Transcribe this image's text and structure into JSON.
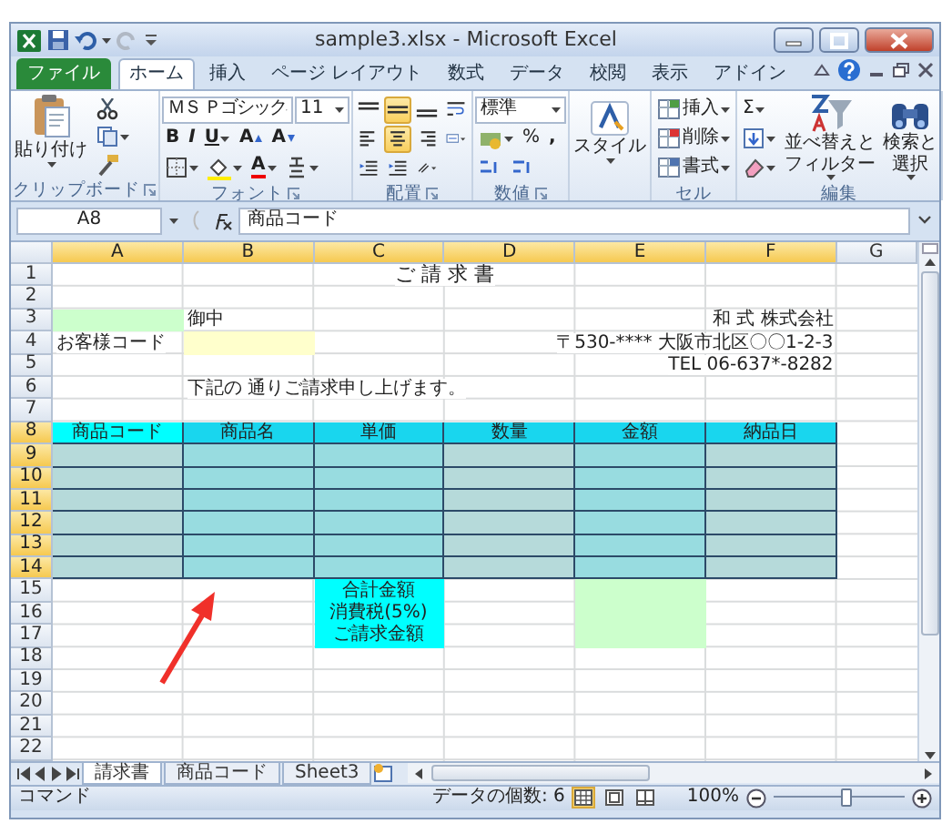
{
  "window": {
    "title": "sample3.xlsx - Microsoft Excel"
  },
  "ribbon_tabs": [
    {
      "label": "ファイル",
      "kind": "file",
      "selected": false
    },
    {
      "label": "ホーム",
      "kind": "tab",
      "selected": true
    },
    {
      "label": "挿入",
      "kind": "tab",
      "selected": false
    },
    {
      "label": "ページ レイアウト",
      "kind": "tab",
      "selected": false
    },
    {
      "label": "数式",
      "kind": "tab",
      "selected": false
    },
    {
      "label": "データ",
      "kind": "tab",
      "selected": false
    },
    {
      "label": "校閲",
      "kind": "tab",
      "selected": false
    },
    {
      "label": "表示",
      "kind": "tab",
      "selected": false
    },
    {
      "label": "アドイン",
      "kind": "tab",
      "selected": false
    }
  ],
  "clipboard": {
    "paste": "貼り付け",
    "label": "クリップボード"
  },
  "font": {
    "name": "ＭＳ Ｐゴシック",
    "size": "11",
    "bold": "B",
    "italic": "I",
    "underline": "U",
    "grow": "A",
    "shrink": "A",
    "font_color": "A",
    "label": "フォント"
  },
  "alignment": {
    "label": "配置",
    "buttons": [
      {
        "on": false
      },
      {
        "on": true
      },
      {
        "on": false
      },
      {
        "on": false
      },
      {
        "on": false
      },
      {
        "on": true
      },
      {
        "on": false
      },
      {
        "on": false
      },
      {
        "on": false
      },
      {
        "on": false
      },
      {
        "on": false
      }
    ]
  },
  "number": {
    "format": "標準",
    "percent": "%",
    "comma": ",",
    "label": "数値"
  },
  "styles": {
    "button": "スタイル"
  },
  "cells": {
    "insert": "挿入",
    "delete": "削除",
    "format": "書式",
    "label": "セル"
  },
  "editing": {
    "sum": "Σ",
    "sort": [
      "並べ替えと",
      "フィルター"
    ],
    "find": [
      "検索と",
      "選択"
    ],
    "label": "編集"
  },
  "formula_bar": {
    "name_box": "A8",
    "formula": "商品コード"
  },
  "columns": [
    {
      "label": "A",
      "selected": true
    },
    {
      "label": "B",
      "selected": true
    },
    {
      "label": "C",
      "selected": true
    },
    {
      "label": "D",
      "selected": true
    },
    {
      "label": "E",
      "selected": true
    },
    {
      "label": "F",
      "selected": true
    },
    {
      "label": "G",
      "selected": false
    }
  ],
  "rows": [
    {
      "header": "1",
      "selected": false,
      "banner": "ご 請 求 書"
    },
    {
      "header": "2",
      "selected": false
    },
    {
      "header": "3",
      "selected": false,
      "cells": [
        {
          "color": "#ccffcc"
        },
        {
          "text": "御中"
        },
        {},
        {},
        {},
        {
          "text": "和 式 株式会社",
          "right_aligned": true
        }
      ]
    },
    {
      "header": "4",
      "selected": false,
      "cells": [
        {
          "text": "お客様コード"
        },
        {
          "color": "#ffffcc"
        },
        {},
        {},
        {},
        {
          "text": "〒530-**** 大阪市北区〇〇1-2-3",
          "right_aligned": true
        }
      ]
    },
    {
      "header": "5",
      "selected": false,
      "cells": [
        {},
        {},
        {},
        {},
        {},
        {
          "text": "TEL 06-637*-8282",
          "right_aligned": true
        }
      ]
    },
    {
      "header": "6",
      "selected": false,
      "cells": [
        {},
        {
          "text": "下記の 通りご請求申し上げます。"
        }
      ]
    },
    {
      "header": "7",
      "selected": false
    },
    {
      "header": "8",
      "selected": true,
      "bordered": true,
      "cells": [
        {
          "text": "商品コード",
          "centered": true,
          "color": "#00ffff"
        },
        {
          "text": "商品名",
          "centered": true,
          "color": "#19d6ee"
        },
        {
          "text": "単価",
          "centered": true,
          "color": "#19d6ee"
        },
        {
          "text": "数量",
          "centered": true,
          "color": "#19d6ee"
        },
        {
          "text": "金額",
          "centered": true,
          "color": "#19d6ee"
        },
        {
          "text": "納品日",
          "centered": true,
          "color": "#19d6ee"
        }
      ]
    },
    {
      "header": "9",
      "selected": true,
      "bordered": true,
      "cells": [
        {
          "color": "#b6dada"
        },
        {
          "color": "#98dce0"
        },
        {
          "color": "#98dce0"
        },
        {
          "color": "#b6dada"
        },
        {
          "color": "#98dce0"
        },
        {
          "color": "#b6dada"
        }
      ]
    },
    {
      "header": "10",
      "selected": true,
      "bordered": true,
      "cells": [
        {
          "color": "#b6dada"
        },
        {
          "color": "#98dce0"
        },
        {
          "color": "#98dce0"
        },
        {
          "color": "#b6dada"
        },
        {
          "color": "#98dce0"
        },
        {
          "color": "#b6dada"
        }
      ]
    },
    {
      "header": "11",
      "selected": true,
      "bordered": true,
      "cells": [
        {
          "color": "#b6dada"
        },
        {
          "color": "#98dce0"
        },
        {
          "color": "#98dce0"
        },
        {
          "color": "#b6dada"
        },
        {
          "color": "#98dce0"
        },
        {
          "color": "#b6dada"
        }
      ]
    },
    {
      "header": "12",
      "selected": true,
      "bordered": true,
      "cells": [
        {
          "color": "#b6dada"
        },
        {
          "color": "#98dce0"
        },
        {
          "color": "#98dce0"
        },
        {
          "color": "#b6dada"
        },
        {
          "color": "#98dce0"
        },
        {
          "color": "#b6dada"
        }
      ]
    },
    {
      "header": "13",
      "selected": true,
      "bordered": true,
      "cells": [
        {
          "color": "#b6dada"
        },
        {
          "color": "#98dce0"
        },
        {
          "color": "#98dce0"
        },
        {
          "color": "#b6dada"
        },
        {
          "color": "#98dce0"
        },
        {
          "color": "#b6dada"
        }
      ]
    },
    {
      "header": "14",
      "selected": true,
      "bordered": true,
      "cells": [
        {
          "color": "#b6dada"
        },
        {
          "color": "#98dce0"
        },
        {
          "color": "#98dce0"
        },
        {
          "color": "#b6dada"
        },
        {
          "color": "#98dce0"
        },
        {
          "color": "#b6dada"
        }
      ]
    },
    {
      "header": "15",
      "selected": false,
      "cells": [
        {},
        {},
        {
          "text": "合計金額",
          "centered": true,
          "color": "#00ffff"
        },
        {},
        {
          "color": "#ccffcc"
        }
      ]
    },
    {
      "header": "16",
      "selected": false,
      "cells": [
        {},
        {},
        {
          "text": "消費税(5%)",
          "centered": true,
          "color": "#00ffff"
        },
        {},
        {
          "color": "#ccffcc"
        }
      ]
    },
    {
      "header": "17",
      "selected": false,
      "cells": [
        {},
        {},
        {
          "text": "ご請求金額",
          "centered": true,
          "color": "#00ffff"
        },
        {},
        {
          "color": "#ccffcc"
        }
      ]
    },
    {
      "header": "18",
      "selected": false
    },
    {
      "header": "19",
      "selected": false
    },
    {
      "header": "20",
      "selected": false
    },
    {
      "header": "21",
      "selected": false
    },
    {
      "header": "22",
      "selected": false
    }
  ],
  "sheet_tabs": [
    {
      "label": "請求書",
      "selected": true
    },
    {
      "label": "商品コード",
      "selected": false
    },
    {
      "label": "Sheet3",
      "selected": false
    }
  ],
  "status_bar": {
    "mode": "コマンド",
    "count": "データの個数: 6",
    "zoom": "100%",
    "zoom_slider": {
      "level": 0.55
    },
    "views": [
      {
        "selected": true
      },
      {
        "selected": false
      },
      {
        "selected": false
      }
    ]
  }
}
